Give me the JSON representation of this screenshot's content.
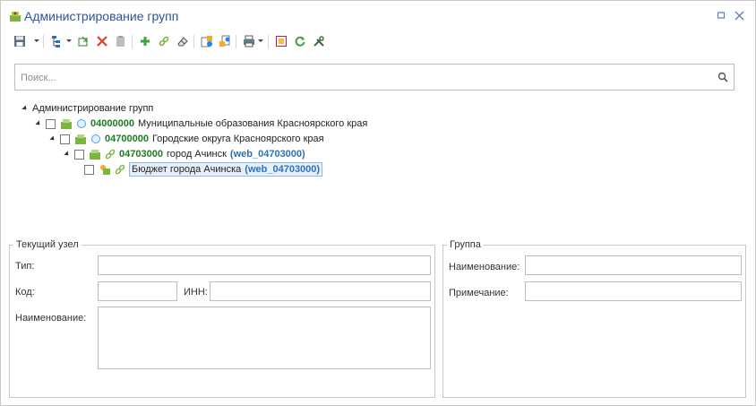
{
  "window": {
    "title": "Администрирование групп",
    "minimize_icon": "restore-icon",
    "close_icon": "close-icon"
  },
  "toolbar": {
    "buttons": [
      {
        "name": "save-icon"
      },
      {
        "name": "tree-options-icon"
      },
      {
        "name": "move-icon"
      },
      {
        "name": "delete-icon"
      },
      {
        "name": "paste-icon"
      },
      {
        "name": "add-icon"
      },
      {
        "name": "link-icon"
      },
      {
        "name": "clear-icon"
      },
      {
        "name": "copy-users-icon"
      },
      {
        "name": "copy-users-2-icon"
      },
      {
        "name": "print-icon"
      },
      {
        "name": "report-icon"
      },
      {
        "name": "refresh-icon"
      },
      {
        "name": "settings-icon"
      }
    ]
  },
  "search": {
    "placeholder": "Поиск..."
  },
  "tree": {
    "root": "Администрирование групп",
    "nodes": [
      {
        "code": "04000000",
        "name": "Муниципальные образования Красноярского края"
      },
      {
        "code": "04700000",
        "name": "Городские округа Красноярского края"
      },
      {
        "code": "04703000",
        "name": "город Ачинск",
        "web": "(web_04703000)"
      },
      {
        "name": "Бюджет города Ачинска",
        "web": "(web_04703000)"
      }
    ]
  },
  "current_node": {
    "legend": "Текущий узел",
    "type_label": "Тип:",
    "type_value": "",
    "code_label": "Код:",
    "code_value": "",
    "inn_label": "ИНН:",
    "inn_value": "",
    "name_label": "Наименование:",
    "name_value": ""
  },
  "group": {
    "legend": "Группа",
    "name_label": "Наименование:",
    "name_value": "",
    "note_label": "Примечание:",
    "note_value": ""
  },
  "colors": {
    "title": "#2b579a",
    "code": "#1e7a1e",
    "web": "#2f6fb7",
    "selection_border": "#8fb7e6"
  }
}
